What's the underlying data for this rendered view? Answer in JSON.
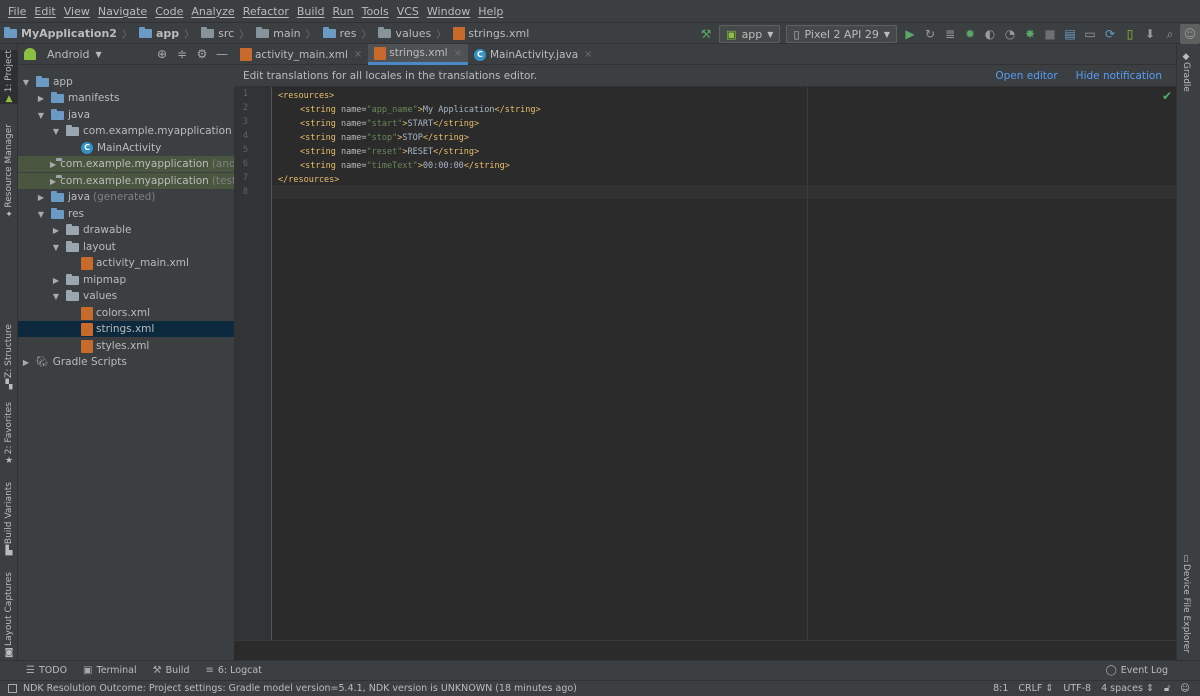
{
  "menu": [
    "File",
    "Edit",
    "View",
    "Navigate",
    "Code",
    "Analyze",
    "Refactor",
    "Build",
    "Run",
    "Tools",
    "VCS",
    "Window",
    "Help"
  ],
  "breadcrumb": [
    "MyApplication2",
    "app",
    "src",
    "main",
    "res",
    "values",
    "strings.xml"
  ],
  "run_config": "app",
  "device": "Pixel 2 API 29",
  "left_tabs": [
    "1: Project",
    "Resource Manager",
    "Z: Structure",
    "2: Favorites",
    "Build Variants",
    "Layout Captures"
  ],
  "right_tabs": [
    "Gradle",
    "Device File Explorer"
  ],
  "project_view": "Android",
  "tree": [
    {
      "label": "app",
      "toggle": "▼",
      "icon": "folder-blue",
      "indent": 0
    },
    {
      "label": "manifests",
      "toggle": "▶",
      "icon": "folder-blue",
      "indent": 1
    },
    {
      "label": "java",
      "toggle": "▼",
      "icon": "folder-blue",
      "indent": 1
    },
    {
      "label": "com.example.myapplication",
      "toggle": "▼",
      "icon": "package",
      "indent": 2
    },
    {
      "label": "MainActivity",
      "toggle": "",
      "icon": "class",
      "indent": 3
    },
    {
      "label": "com.example.myapplication",
      "muted": "(andro",
      "toggle": "▶",
      "icon": "package",
      "indent": 2,
      "highlight": "test"
    },
    {
      "label": "com.example.myapplication",
      "muted": "(test)",
      "toggle": "▶",
      "icon": "package",
      "indent": 2,
      "highlight": "test"
    },
    {
      "label": "java",
      "muted": "(generated)",
      "toggle": "▶",
      "icon": "folder-gen",
      "indent": 1
    },
    {
      "label": "res",
      "toggle": "▼",
      "icon": "folder-res",
      "indent": 1
    },
    {
      "label": "drawable",
      "toggle": "▶",
      "icon": "package",
      "indent": 2
    },
    {
      "label": "layout",
      "toggle": "▼",
      "icon": "package",
      "indent": 2
    },
    {
      "label": "activity_main.xml",
      "toggle": "",
      "icon": "xml",
      "indent": 3
    },
    {
      "label": "mipmap",
      "toggle": "▶",
      "icon": "package",
      "indent": 2
    },
    {
      "label": "values",
      "toggle": "▼",
      "icon": "package",
      "indent": 2
    },
    {
      "label": "colors.xml",
      "toggle": "",
      "icon": "xml",
      "indent": 3
    },
    {
      "label": "strings.xml",
      "toggle": "",
      "icon": "xml",
      "indent": 3,
      "highlight": "selected"
    },
    {
      "label": "styles.xml",
      "toggle": "",
      "icon": "xml",
      "indent": 3
    },
    {
      "label": "Gradle Scripts",
      "toggle": "▶",
      "icon": "gradle",
      "indent": 0
    }
  ],
  "editor_tabs": [
    {
      "label": "activity_main.xml",
      "icon": "xml",
      "active": false
    },
    {
      "label": "strings.xml",
      "icon": "xml",
      "active": true
    },
    {
      "label": "MainActivity.java",
      "icon": "class",
      "active": false
    }
  ],
  "notification": {
    "text": "Edit translations for all locales in the translations editor.",
    "open_editor": "Open editor",
    "hide": "Hide notification"
  },
  "code_lines": [
    {
      "n": "1",
      "parts": [
        [
          "tag",
          "<resources>"
        ]
      ],
      "indent": 0
    },
    {
      "n": "2",
      "parts": [
        [
          "tag",
          "<string "
        ],
        [
          "attr",
          "name="
        ],
        [
          "val",
          "\"app_name\""
        ],
        [
          "tag",
          ">"
        ],
        [
          "txt",
          "My Application"
        ],
        [
          "tag",
          "</string>"
        ]
      ],
      "indent": 1
    },
    {
      "n": "3",
      "parts": [
        [
          "tag",
          "<string "
        ],
        [
          "attr",
          "name="
        ],
        [
          "val",
          "\"start\""
        ],
        [
          "tag",
          ">"
        ],
        [
          "txt",
          "START"
        ],
        [
          "tag",
          "</string>"
        ]
      ],
      "indent": 1
    },
    {
      "n": "4",
      "parts": [
        [
          "tag",
          "<string "
        ],
        [
          "attr",
          "name="
        ],
        [
          "val",
          "\"stop\""
        ],
        [
          "tag",
          ">"
        ],
        [
          "txt",
          "STOP"
        ],
        [
          "tag",
          "</string>"
        ]
      ],
      "indent": 1
    },
    {
      "n": "5",
      "parts": [
        [
          "tag",
          "<string "
        ],
        [
          "attr",
          "name="
        ],
        [
          "val",
          "\"reset\""
        ],
        [
          "tag",
          ">"
        ],
        [
          "txt",
          "RESET"
        ],
        [
          "tag",
          "</string>"
        ]
      ],
      "indent": 1
    },
    {
      "n": "6",
      "parts": [
        [
          "tag",
          "<string "
        ],
        [
          "attr",
          "name="
        ],
        [
          "val",
          "\"timeText\""
        ],
        [
          "tag",
          ">"
        ],
        [
          "txt",
          "00:00:00"
        ],
        [
          "tag",
          "</string>"
        ]
      ],
      "indent": 1
    },
    {
      "n": "7",
      "parts": [
        [
          "tag",
          "</resources>"
        ]
      ],
      "indent": 0
    },
    {
      "n": "8",
      "parts": [],
      "indent": 0
    }
  ],
  "bottom_tools": [
    {
      "label": "TODO",
      "icon": "list-icon"
    },
    {
      "label": "Terminal",
      "icon": "terminal-icon"
    },
    {
      "label": "Build",
      "icon": "hammer-icon"
    },
    {
      "label": "6: Logcat",
      "icon": "logcat-icon"
    }
  ],
  "event_log": "Event Log",
  "status": {
    "message": "NDK Resolution Outcome: Project settings: Gradle model version=5.4.1, NDK version is UNKNOWN (18 minutes ago)",
    "position": "8:1",
    "line_sep": "CRLF ⇕",
    "encoding": "UTF-8",
    "indent": "4 spaces ⇕"
  }
}
